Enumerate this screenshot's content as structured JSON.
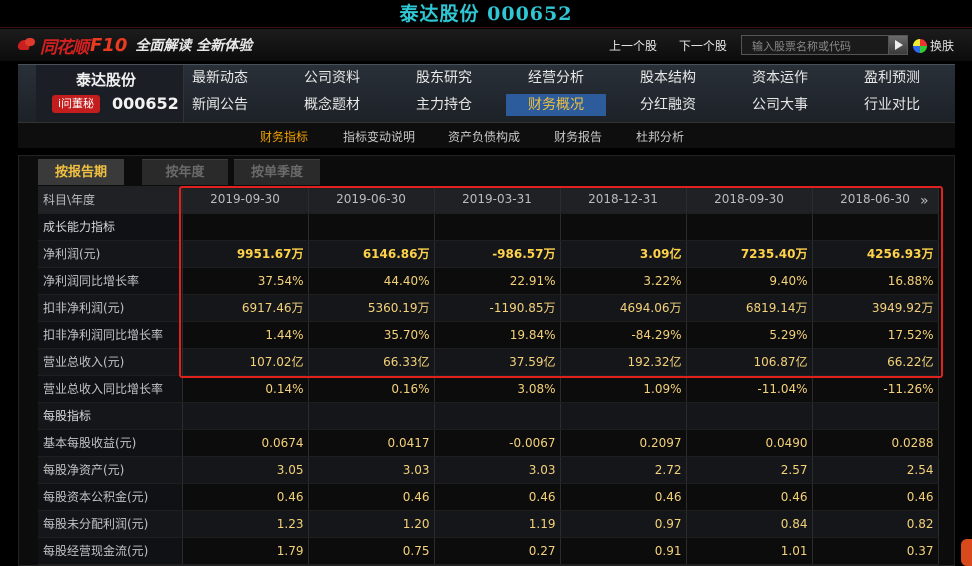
{
  "window_title": "泰达股份 000652",
  "topbar": {
    "logo_text": "同花顺",
    "logo_f10": "F10",
    "slogan": "全面解读 全新体验",
    "prev_stock": "上一个股",
    "next_stock": "下一个股",
    "search_placeholder": "输入股票名称或代码",
    "skin_label": "换肤"
  },
  "stock": {
    "name": "泰达股份",
    "badge": "i问董秘",
    "code": "000652"
  },
  "menu": {
    "row1": [
      "最新动态",
      "公司资料",
      "股东研究",
      "经营分析",
      "股本结构",
      "资本运作",
      "盈利预测"
    ],
    "row2": [
      "新闻公告",
      "概念题材",
      "主力持仓",
      "财务概况",
      "分红融资",
      "公司大事",
      "行业对比"
    ],
    "active": "财务概况"
  },
  "submenu": [
    "财务指标",
    "指标变动说明",
    "资产负债构成",
    "财务报告",
    "杜邦分析"
  ],
  "tabs": [
    "按报告期",
    "按年度",
    "按单季度"
  ],
  "table": {
    "header_label": "科目\\年度",
    "columns": [
      "2019-09-30",
      "2019-06-30",
      "2019-03-31",
      "2018-12-31",
      "2018-09-30",
      "2018-06-30"
    ],
    "rows": [
      {
        "label": "成长能力指标",
        "section": true,
        "values": [
          "",
          "",
          "",
          "",
          "",
          ""
        ]
      },
      {
        "label": "净利润(元)",
        "bold": true,
        "values": [
          "9951.67万",
          "6146.86万",
          "-986.57万",
          "3.09亿",
          "7235.40万",
          "4256.93万"
        ]
      },
      {
        "label": "净利润同比增长率",
        "values": [
          "37.54%",
          "44.40%",
          "22.91%",
          "3.22%",
          "9.40%",
          "16.88%"
        ]
      },
      {
        "label": "扣非净利润(元)",
        "values": [
          "6917.46万",
          "5360.19万",
          "-1190.85万",
          "4694.06万",
          "6819.14万",
          "3949.92万"
        ]
      },
      {
        "label": "扣非净利润同比增长率",
        "values": [
          "1.44%",
          "35.70%",
          "19.84%",
          "-84.29%",
          "5.29%",
          "17.52%"
        ]
      },
      {
        "label": "营业总收入(元)",
        "values": [
          "107.02亿",
          "66.33亿",
          "37.59亿",
          "192.32亿",
          "106.87亿",
          "66.22亿"
        ]
      },
      {
        "label": "营业总收入同比增长率",
        "values": [
          "0.14%",
          "0.16%",
          "3.08%",
          "1.09%",
          "-11.04%",
          "-11.26%"
        ]
      },
      {
        "label": "每股指标",
        "section": true,
        "values": [
          "",
          "",
          "",
          "",
          "",
          ""
        ]
      },
      {
        "label": "基本每股收益(元)",
        "values": [
          "0.0674",
          "0.0417",
          "-0.0067",
          "0.2097",
          "0.0490",
          "0.0288"
        ]
      },
      {
        "label": "每股净资产(元)",
        "values": [
          "3.05",
          "3.03",
          "3.03",
          "2.72",
          "2.57",
          "2.54"
        ]
      },
      {
        "label": "每股资本公积金(元)",
        "values": [
          "0.46",
          "0.46",
          "0.46",
          "0.46",
          "0.46",
          "0.46"
        ]
      },
      {
        "label": "每股未分配利润(元)",
        "values": [
          "1.23",
          "1.20",
          "1.19",
          "0.97",
          "0.84",
          "0.82"
        ]
      },
      {
        "label": "每股经营现金流(元)",
        "values": [
          "1.79",
          "0.75",
          "0.27",
          "0.91",
          "1.01",
          "0.37"
        ]
      }
    ]
  },
  "more_columns_glyph": "»",
  "colors": {
    "title_cyan": "#2ec7d3",
    "highlight_box": "#e0221c",
    "value_gold": "#f5d27a",
    "active_tab": "#f0c040",
    "active_menu_bg": "#2c5c9c"
  }
}
